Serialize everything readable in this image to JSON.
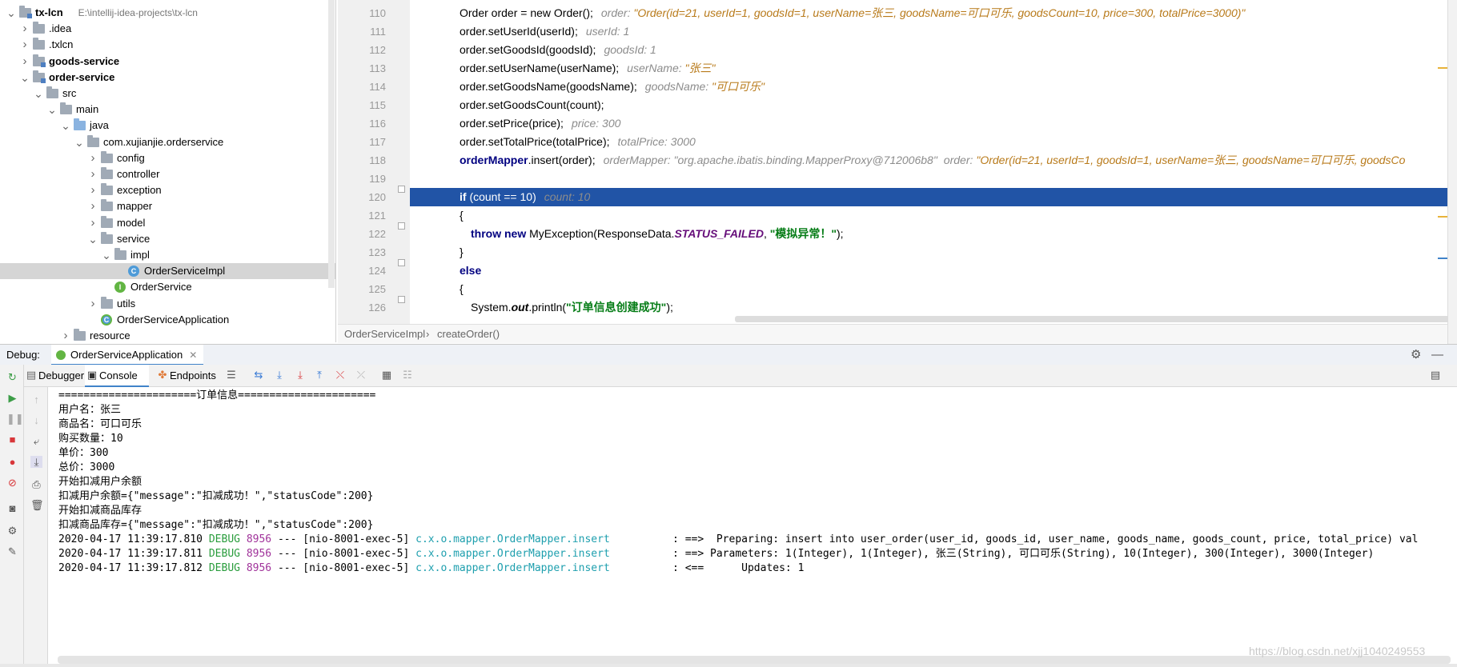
{
  "project_tree": {
    "items": [
      {
        "label": "tx-lcn",
        "path": "E:\\intellij-idea-projects\\tx-lcn",
        "bold": true,
        "indent": 0,
        "arrow": "down",
        "icon": "folder-mod"
      },
      {
        "label": ".idea",
        "indent": 1,
        "arrow": "right",
        "icon": "folder"
      },
      {
        "label": ".txlcn",
        "indent": 1,
        "arrow": "right",
        "icon": "folder"
      },
      {
        "label": "goods-service",
        "bold": true,
        "indent": 1,
        "arrow": "right",
        "icon": "folder-mod"
      },
      {
        "label": "order-service",
        "bold": true,
        "indent": 1,
        "arrow": "down",
        "icon": "folder-mod"
      },
      {
        "label": "src",
        "indent": 2,
        "arrow": "down",
        "icon": "folder"
      },
      {
        "label": "main",
        "indent": 3,
        "arrow": "down",
        "icon": "folder"
      },
      {
        "label": "java",
        "indent": 4,
        "arrow": "down",
        "icon": "folder-blue"
      },
      {
        "label": "com.xujianjie.orderservice",
        "indent": 5,
        "arrow": "down",
        "icon": "folder"
      },
      {
        "label": "config",
        "indent": 6,
        "arrow": "right",
        "icon": "folder"
      },
      {
        "label": "controller",
        "indent": 6,
        "arrow": "right",
        "icon": "folder"
      },
      {
        "label": "exception",
        "indent": 6,
        "arrow": "right",
        "icon": "folder"
      },
      {
        "label": "mapper",
        "indent": 6,
        "arrow": "right",
        "icon": "folder"
      },
      {
        "label": "model",
        "indent": 6,
        "arrow": "right",
        "icon": "folder"
      },
      {
        "label": "service",
        "indent": 6,
        "arrow": "down",
        "icon": "folder"
      },
      {
        "label": "impl",
        "indent": 7,
        "arrow": "down",
        "icon": "folder"
      },
      {
        "label": "OrderServiceImpl",
        "indent": 8,
        "arrow": "",
        "icon": "class",
        "selected": true
      },
      {
        "label": "OrderService",
        "indent": 7,
        "arrow": "",
        "icon": "interface"
      },
      {
        "label": "utils",
        "indent": 6,
        "arrow": "right",
        "icon": "folder"
      },
      {
        "label": "OrderServiceApplication",
        "indent": 6,
        "arrow": "",
        "icon": "app"
      },
      {
        "label": "resource",
        "indent": 4,
        "arrow": "right",
        "icon": "folder"
      }
    ]
  },
  "editor": {
    "lines": [
      {
        "num": "110",
        "code": "Order order = new Order();",
        "hint": "order: \"Order(id=21, userId=1, goodsId=1, userName=张三, goodsName=可口可乐, goodsCount=10, price=300, totalPrice=3000)\""
      },
      {
        "num": "111",
        "code": "order.setUserId(userId);",
        "hint": "userId: 1"
      },
      {
        "num": "112",
        "code": "order.setGoodsId(goodsId);",
        "hint": "goodsId: 1"
      },
      {
        "num": "113",
        "code": "order.setUserName(userName);",
        "hint": "userName: \"张三\""
      },
      {
        "num": "114",
        "code": "order.setGoodsName(goodsName);",
        "hint": "goodsName: \"可口可乐\""
      },
      {
        "num": "115",
        "code": "order.setGoodsCount(count);",
        "hint": ""
      },
      {
        "num": "116",
        "code": "order.setPrice(price);",
        "hint": "price: 300"
      },
      {
        "num": "117",
        "code": "order.setTotalPrice(totalPrice);",
        "hint": "totalPrice: 3000"
      },
      {
        "num": "118",
        "code_a": "orderMapper",
        "code_b": ".insert(order);",
        "hint": "orderMapper: \"org.apache.ibatis.binding.MapperProxy@712006b8\"",
        "hint2_label": "order:",
        "hint2_value": "\"Order(id=21, userId=1, goodsId=1, userName=张三, goodsName=可口可乐, goodsCo"
      },
      {
        "num": "119",
        "code": "",
        "hint": ""
      },
      {
        "num": "120",
        "code_kw": "if",
        "code": " (count == 10)",
        "hint": "count: 10"
      },
      {
        "num": "121",
        "code": "{",
        "hint": ""
      },
      {
        "num": "122",
        "code_kw": "throw new",
        "code_a": " MyException(ResponseData.",
        "code_field": "STATUS_FAILED",
        "code_b": ", ",
        "code_str": "\"模拟异常！\"",
        "code_c": ");"
      },
      {
        "num": "123",
        "code": "}",
        "hint": ""
      },
      {
        "num": "124",
        "code_kw": "else",
        "code": "",
        "hint": ""
      },
      {
        "num": "125",
        "code": "{",
        "hint": ""
      },
      {
        "num": "126",
        "code_a": "System.",
        "code_field": "out",
        "code_b": ".println(",
        "code_str": "\"订单信息创建成功\"",
        "code_c": ");"
      }
    ]
  },
  "breadcrumb": {
    "class_name": "OrderServiceImpl",
    "separator": "›",
    "method": "createOrder()"
  },
  "debug": {
    "title": "Debug:",
    "config_tab": "OrderServiceApplication",
    "tabs": {
      "debugger": "Debugger",
      "console": "Console",
      "endpoints": "Endpoints"
    }
  },
  "console": {
    "plain_lines": [
      "======================订单信息======================",
      "用户名：张三",
      "商品名：可口可乐",
      "购买数量：10",
      "单价：300",
      "总价：3000",
      "开始扣减用户余额",
      "扣减用户余额={\"message\":\"扣减成功！\",\"statusCode\":200}",
      "开始扣减商品库存",
      "扣减商品库存={\"message\":\"扣减成功！\",\"statusCode\":200}"
    ],
    "log_lines": [
      {
        "time": "2020-04-17 11:39:17.810",
        "level": "DEBUG",
        "pid": "8956",
        "thread": " --- [nio-8001-exec-5] ",
        "logger": "c.x.o.mapper.OrderMapper.insert",
        "msg": "          : ==>  Preparing: insert into user_order(user_id, goods_id, user_name, goods_name, goods_count, price, total_price) val"
      },
      {
        "time": "2020-04-17 11:39:17.811",
        "level": "DEBUG",
        "pid": "8956",
        "thread": " --- [nio-8001-exec-5] ",
        "logger": "c.x.o.mapper.OrderMapper.insert",
        "msg": "          : ==> Parameters: 1(Integer), 1(Integer), 张三(String), 可口可乐(String), 10(Integer), 300(Integer), 3000(Integer)"
      },
      {
        "time": "2020-04-17 11:39:17.812",
        "level": "DEBUG",
        "pid": "8956",
        "thread": " --- [nio-8001-exec-5] ",
        "logger": "c.x.o.mapper.OrderMapper.insert",
        "msg": "          : <==      Updates: 1"
      }
    ]
  },
  "watermark": "https://blog.csdn.net/xjj1040249553",
  "colors": {
    "selection": "#2154a6",
    "keyword": "#000080",
    "string": "#067d17",
    "hint": "#8c8c8c",
    "debug_level": "#2a9d3d",
    "pid": "#a0329a",
    "logger": "#1e9fae"
  }
}
